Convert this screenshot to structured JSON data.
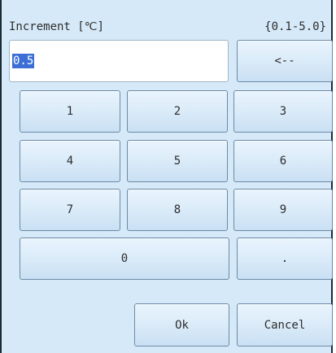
{
  "dialog": {
    "title": "Increment [℃]",
    "range": "{0.1-5.0}",
    "value": "0.5"
  },
  "keys": {
    "backspace": "<--",
    "k1": "1",
    "k2": "2",
    "k3": "3",
    "k4": "4",
    "k5": "5",
    "k6": "6",
    "k7": "7",
    "k8": "8",
    "k9": "9",
    "k0": "0",
    "dot": "."
  },
  "actions": {
    "ok": "Ok",
    "cancel": "Cancel"
  }
}
